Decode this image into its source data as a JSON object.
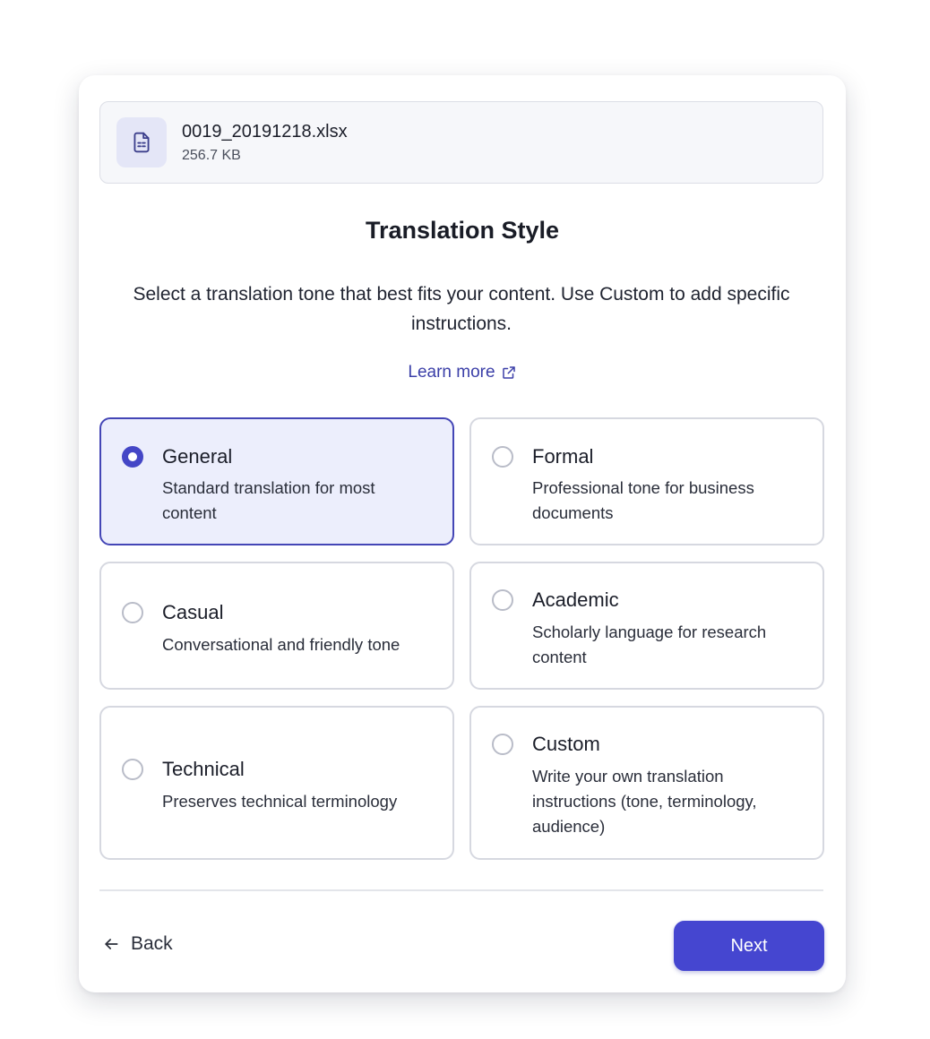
{
  "file": {
    "icon": "spreadsheet-file-icon",
    "name": "0019_20191218.xlsx",
    "size": "256.7 KB"
  },
  "title": "Translation Style",
  "subtitle": "Select a translation tone that best fits your content. Use Custom to add specific instructions.",
  "learn_more": {
    "label": "Learn more",
    "icon": "external-link-icon"
  },
  "options": [
    {
      "title": "General",
      "description": "Standard translation for most content",
      "selected": true
    },
    {
      "title": "Formal",
      "description": "Professional tone for business documents",
      "selected": false
    },
    {
      "title": "Casual",
      "description": "Conversational and friendly tone",
      "selected": false
    },
    {
      "title": "Academic",
      "description": "Scholarly language for research content",
      "selected": false
    },
    {
      "title": "Technical",
      "description": "Preserves technical terminology",
      "selected": false
    },
    {
      "title": "Custom",
      "description": "Write your own translation instructions (tone, terminology, audience)",
      "selected": false
    }
  ],
  "footer": {
    "back_label": "Back",
    "back_icon": "arrow-left-icon",
    "next_label": "Next"
  },
  "colors": {
    "accent": "#4546d0",
    "selected_bg": "#eceefc",
    "link": "#3b3fa8"
  }
}
